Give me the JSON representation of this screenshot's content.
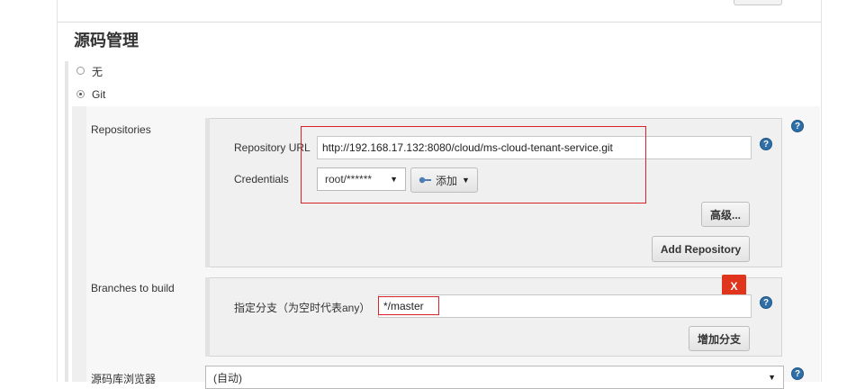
{
  "section": {
    "title": "源码管理"
  },
  "scm_options": [
    {
      "label": "无",
      "selected": false
    },
    {
      "label": "Git",
      "selected": true
    }
  ],
  "repositories": {
    "label": "Repositories",
    "url_label": "Repository URL",
    "url_value": "http://192.168.17.132:8080/cloud/ms-cloud-tenant-service.git",
    "credentials_label": "Credentials",
    "credentials_value": "root/******",
    "add_label": "添加",
    "advanced_label": "高级...",
    "add_repository_label": "Add Repository"
  },
  "branches": {
    "label": "Branches to build",
    "branch_label": "指定分支（为空时代表any）",
    "branch_value": "*/master",
    "delete_label": "X",
    "add_branch_label": "增加分支"
  },
  "browser": {
    "label": "源码库浏览器",
    "value": "(自动)"
  },
  "help_glyph": "?",
  "colors": {
    "accent_red": "#d9222a",
    "help_blue": "#2f6ea6",
    "delete_red": "#e0341d"
  }
}
